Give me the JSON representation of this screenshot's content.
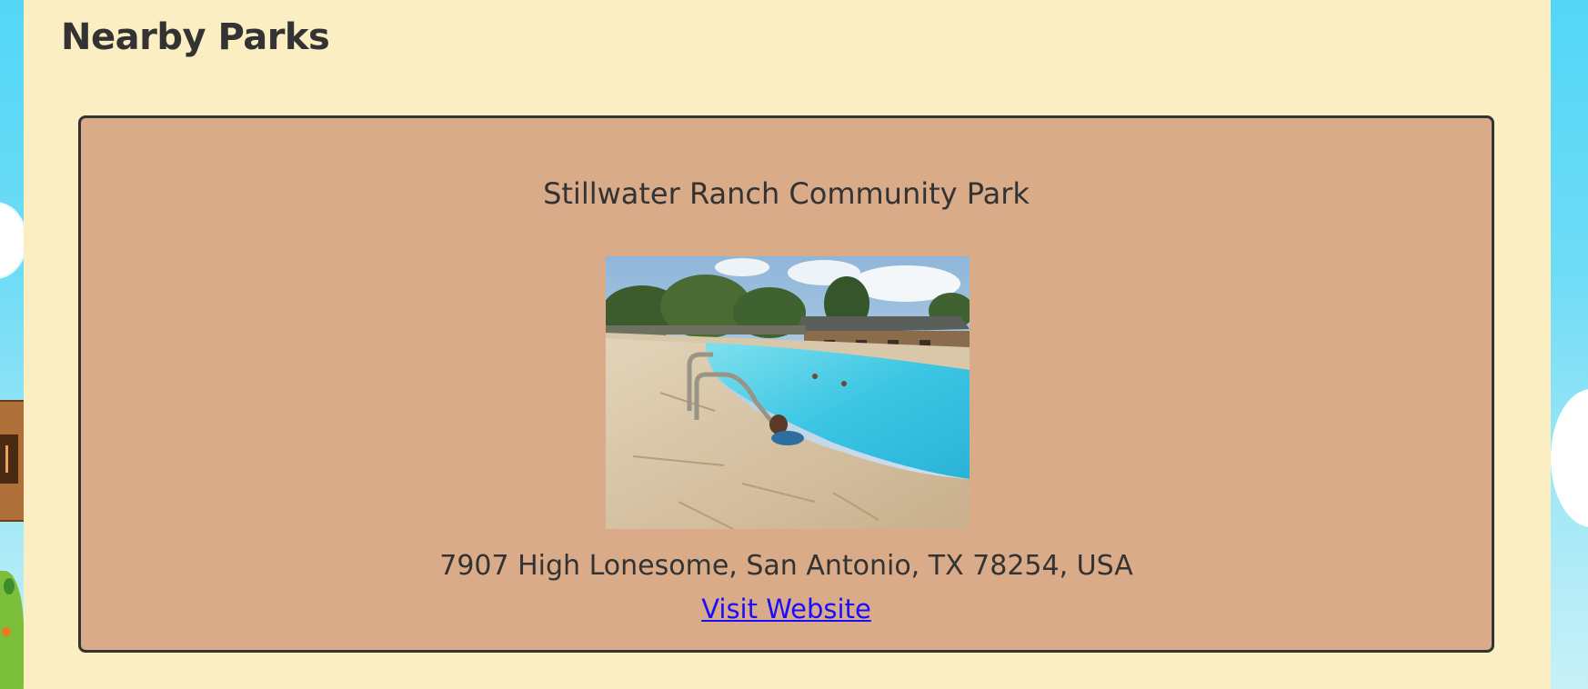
{
  "page": {
    "title": "Nearby Parks"
  },
  "parks": [
    {
      "name": "Stillwater Ranch Community Park",
      "photo_alt": "Stillwater Ranch Community Park",
      "address": "7907 High Lonesome, San Antonio, TX 78254, USA",
      "link_label": "Visit Website"
    }
  ],
  "colors": {
    "sky": "#53d7f7",
    "panel_background": "#fbeec2",
    "card_background": "#d9ab88",
    "card_border": "#333333",
    "text": "#333333",
    "link": "#1a0dff"
  },
  "icons": {
    "decorations": [
      "cloud",
      "wooden-sign",
      "bush",
      "cloud"
    ]
  }
}
